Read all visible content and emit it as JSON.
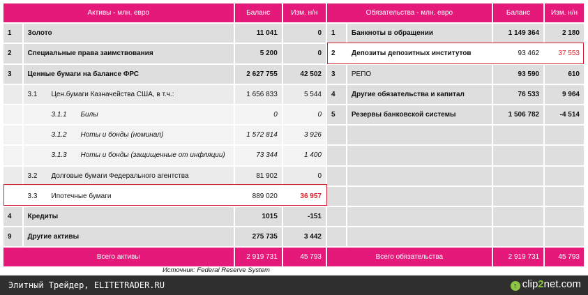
{
  "colors": {
    "header": "#e5197a",
    "highlight_border": "#d02030",
    "negative_red": "#d91f26",
    "footer": "#2f2f2f",
    "brand_green": "#8dc63f"
  },
  "assets": {
    "header": {
      "title": "Активы - млн. евро",
      "balance": "Баланс",
      "change": "Изм. н/н"
    },
    "rows": [
      {
        "level": 1,
        "idx": "1",
        "label": "Золото",
        "balance": "11 041",
        "change": "0"
      },
      {
        "level": 1,
        "idx": "2",
        "label": "Специальные права заимствования",
        "balance": "5 200",
        "change": "0"
      },
      {
        "level": 1,
        "idx": "3",
        "label": "Ценные бумаги на балансе ФРС",
        "balance": "2 627 755",
        "change": "42 502"
      },
      {
        "level": 2,
        "idx": "3.1",
        "label": "Цен.бумаги Казначейства США, в т.ч.:",
        "balance": "1 656 833",
        "change": "5 544"
      },
      {
        "level": 3,
        "idx": "3.1.1",
        "label": "Билы",
        "balance": "0",
        "change": "0"
      },
      {
        "level": 3,
        "idx": "3.1.2",
        "label": "Ноты и бонды (номинал)",
        "balance": "1 572 814",
        "change": "3 926"
      },
      {
        "level": 3,
        "idx": "3.1.3",
        "label": "Ноты и бонды (защищенные от инфляции)",
        "balance": "73 344",
        "change": "1 400"
      },
      {
        "level": 2,
        "idx": "3.2",
        "label": "Долговые бумаги Федерального агентства",
        "balance": "81 902",
        "change": "0"
      },
      {
        "level": 2,
        "idx": "3.3",
        "label": "Ипотечные бумаги",
        "balance": "889 020",
        "change": "36 957",
        "highlight": true
      },
      {
        "level": 1,
        "idx": "4",
        "label": "Кредиты",
        "balance": "1015",
        "change": "-151"
      },
      {
        "level": 1,
        "idx": "9",
        "label": "Другие активы",
        "balance": "275 735",
        "change": "3 442"
      }
    ],
    "total": {
      "label": "Всего активы",
      "balance": "2 919 731",
      "change": "45 793"
    }
  },
  "liabilities": {
    "header": {
      "title": "Обязательства - млн. евро",
      "balance": "Баланс",
      "change": "Изм. н/н"
    },
    "rows": [
      {
        "idx": "1",
        "label": "Банкноты в обращении",
        "balance": "1 149 364",
        "change": "2 180"
      },
      {
        "idx": "2",
        "label": "Депозиты депозитных институтов",
        "balance": "93 462",
        "change": "37 553",
        "highlight": true
      },
      {
        "idx": "3",
        "label": "РЕПО",
        "balance": "93 590",
        "change": "610"
      },
      {
        "idx": "4",
        "label": "Другие обязательства и капитал",
        "balance": "76 533",
        "change": "9 964"
      },
      {
        "idx": "5",
        "label": "Резервы банковской системы",
        "balance": "1 506 782",
        "change": "-4 514"
      }
    ],
    "total": {
      "label": "Всего обязательства",
      "balance": "2 919 731",
      "change": "45 793"
    }
  },
  "source_note": "Источник: Federal Reserve System",
  "footer": {
    "text": "Элитный Трейдер, ELITETRADER.RU",
    "brand_pre": "clip",
    "brand_two": "2",
    "brand_post": "net.com",
    "brand_icon": "↑"
  }
}
